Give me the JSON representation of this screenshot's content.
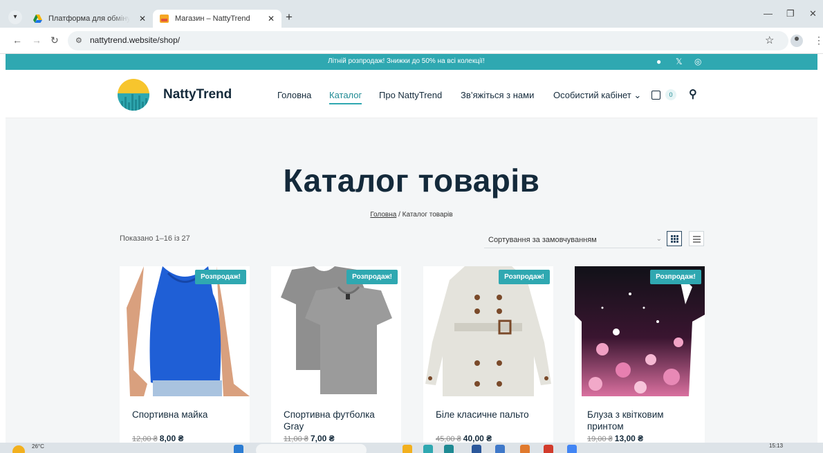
{
  "browser": {
    "tabs": [
      {
        "title": "Платформа для обміну файлами",
        "active": false
      },
      {
        "title": "Магазин – NattyTrend",
        "active": true
      }
    ],
    "new_tab": "+",
    "url": "nattytrend.website/shop/",
    "icons": [
      "tab-search-icon",
      "back-icon",
      "forward-icon",
      "reload-icon",
      "site-info-icon",
      "star-icon",
      "profile-icon",
      "menu-icon",
      "minimize-icon",
      "restore-icon",
      "close-icon"
    ]
  },
  "promo_bar": {
    "text": "Літній розпродаж! Знижки до 50% на всі колекції!",
    "social_icons": [
      "facebook-icon",
      "x-icon",
      "instagram-icon"
    ]
  },
  "header": {
    "logo_text": "NattyTrend",
    "nav": [
      {
        "label": "Головна",
        "active": false
      },
      {
        "label": "Каталог",
        "active": true
      },
      {
        "label": "Про NattyTrend",
        "active": false
      },
      {
        "label": "Зв’яжіться з нами",
        "active": false
      },
      {
        "label": "Особистий кабінет ⌄",
        "active": false
      }
    ],
    "cart_count": "0"
  },
  "catalog": {
    "title": "Каталог товарів",
    "breadcrumb_home": "Головна",
    "breadcrumb_current": "/ Каталог товарів",
    "result_count": "Показано 1–16 із 27",
    "sort_label": "Сортування за замовчуванням",
    "products": [
      {
        "title": "Спортивна майка",
        "old_price": "12,00 ₴",
        "new_price": "8,00 ₴",
        "badge": "Розпродаж!"
      },
      {
        "title": "Спортивна футболка Gray",
        "old_price": "11,00 ₴",
        "new_price": "7,00 ₴",
        "badge": "Розпродаж!"
      },
      {
        "title": "Біле класичне пальто",
        "old_price": "45,00 ₴",
        "new_price": "40,00 ₴",
        "badge": "Розпродаж!"
      },
      {
        "title": "Блуза з квітковим принтом",
        "old_price": "19,00 ₴",
        "new_price": "13,00 ₴",
        "badge": "Розпродаж!"
      }
    ]
  },
  "taskbar": {
    "temperature": "26°C",
    "time": "15:13"
  },
  "colors": {
    "accent": "#2fa8b1",
    "heading": "#142a3b"
  }
}
